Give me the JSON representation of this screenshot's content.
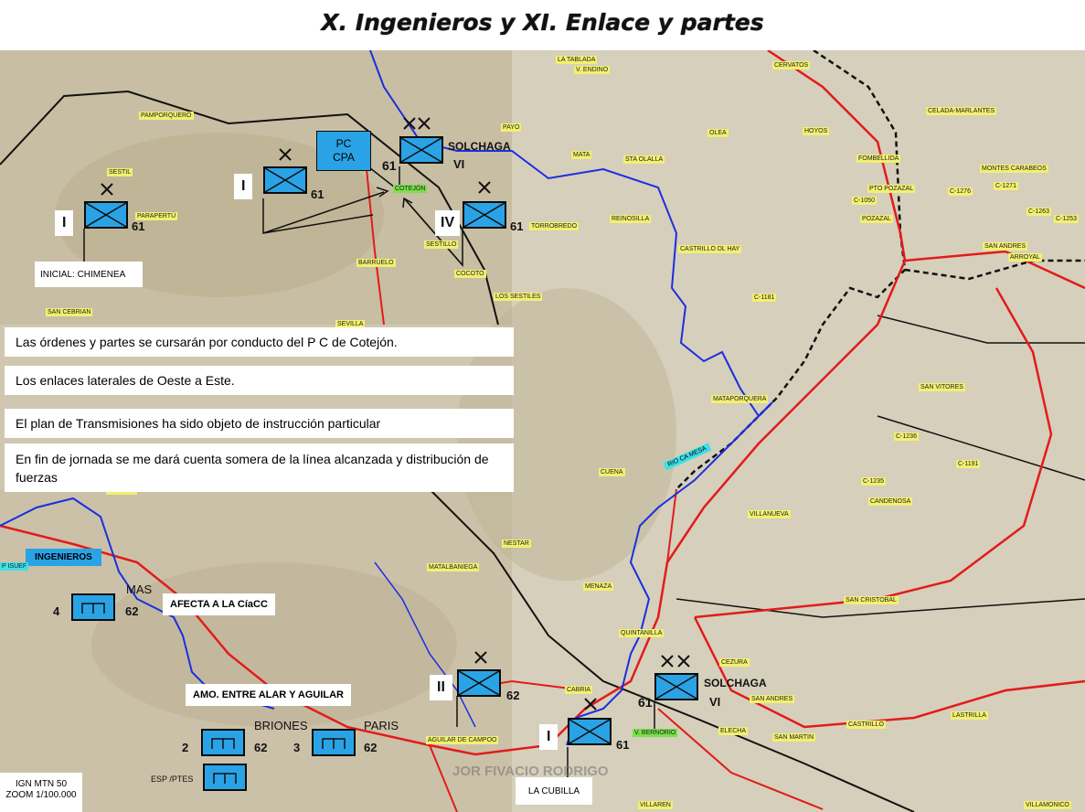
{
  "title": "X. Ingenieros y XI. Enlace y partes",
  "orders": [
    "Las órdenes y partes se cursarán por conducto del P C de Cotejón.",
    "Los enlaces laterales de Oeste a Este.",
    "El plan de Transmisiones ha sido objeto de instrucción particular",
    "En fin de jornada se me dará cuenta somera de la línea alcanzada y distribución de fuerzas"
  ],
  "command_post": {
    "line1": "PC",
    "line2": "CPA"
  },
  "units": [
    {
      "echelon": "I",
      "number": "61"
    },
    {
      "echelon": "I",
      "number": "61"
    },
    {
      "echelon": "IV",
      "number": "61"
    },
    {
      "echelon": "VI",
      "number": "61",
      "name": "SOLCHAGA"
    },
    {
      "echelon": "II",
      "number": "62"
    },
    {
      "echelon": "VI",
      "number": "61",
      "name": "SOLCHAGA"
    },
    {
      "echelon": "I",
      "number": "61"
    }
  ],
  "engineers": {
    "title": "INGENIEROS",
    "units": [
      {
        "number": "4",
        "code": "62",
        "name": "MAS"
      },
      {
        "number": "2",
        "code": "62",
        "name": "BRIONES"
      },
      {
        "number": "3",
        "code": "62",
        "name": "PARIS"
      }
    ],
    "assign_label": "AFECTA A LA CíaCC",
    "ammo_label": "AMO. ENTRE ALAR Y AGUILAR",
    "bridge_label": "ESP /PTES"
  },
  "labels": {
    "initial": "INICIAL: CHIMENEA",
    "la_cubilla": "LA CUBILLA",
    "map_ref_line1": "IGN MTN 50",
    "map_ref_line2": "ZOOM 1/100.000",
    "rio_ca": "RIO CA MESA",
    "ingen_left": "P ISUEF",
    "watermark": "JOR FIVACIO RODRIGO"
  },
  "places": [
    "LA TABLADA",
    "V. ENDINO",
    "CERVATOS",
    "PAMPORQUERO",
    "PAYO",
    "CELADA-MARLANTES",
    "SESTIL",
    "OLEA",
    "HOYOS",
    "MATA",
    "STA OLALLA",
    "FOMBELLIDA",
    "MONTES CARABEOS",
    "PARAPERTÚ",
    "COTEJÓN",
    "PTO POZAZAL",
    "C-1276",
    "C-1271",
    "C-1050",
    "C-1263",
    "C-1253",
    "POZAZAL",
    "REINOSILLA",
    "TORROBREDO",
    "SESTILLO",
    "SAN ANDRES",
    "ARROYAL",
    "CASTRILLO DL HAY",
    "BARRUELO",
    "COCOTO",
    "LOS SESTILES",
    "C-1181",
    "SAN CEBRIAN",
    "SEVILLA",
    "SAN VITORES",
    "MATAPORQUERA",
    "C-1236",
    "C-1191",
    "CUENA",
    "C-1235",
    "CANDENOSA",
    "VILLANUEVA",
    "SALINAS",
    "NESTAR",
    "MATALBANIEGA",
    "MENAZA",
    "SAN CRISTOBAL",
    "QUINTANILLA",
    "CEZURA",
    "CABRIA",
    "SAN ANDRES",
    "LASTRILLA",
    "CASTRILLO",
    "ELECHA",
    "SAN MARTIN",
    "AGUILAR DE CAMPOO",
    "V. BERNORIO",
    "VILLAREN",
    "VILLAMONICO"
  ]
}
